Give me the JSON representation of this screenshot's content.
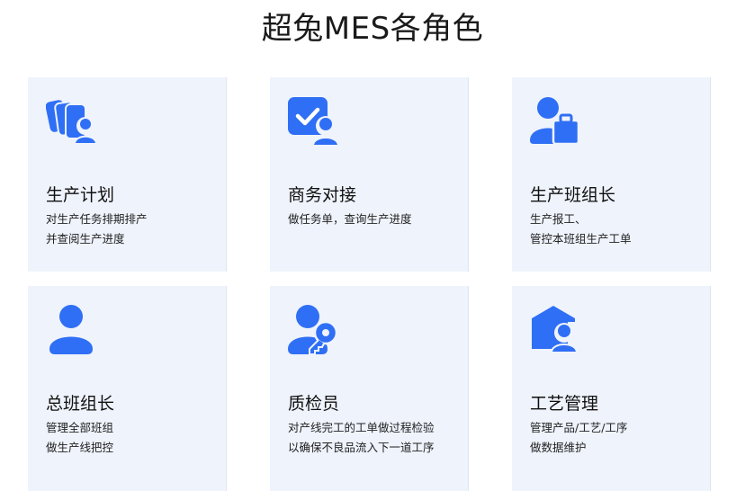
{
  "title": "超兔MES各角色",
  "brand_color": "#2f6ff5",
  "roles": [
    {
      "icon": "people-stack-icon",
      "title": "生产计划",
      "desc": [
        "对生产任务排期排产",
        "并查阅生产进度"
      ]
    },
    {
      "icon": "task-check-user-icon",
      "title": "商务对接",
      "desc": [
        "做任务单，查询生产进度"
      ]
    },
    {
      "icon": "user-briefcase-icon",
      "title": "生产班组长",
      "desc": [
        "生产报工、",
        "管控本班组生产工单"
      ]
    },
    {
      "icon": "user-icon",
      "title": "总班组长",
      "desc": [
        "管理全部班组",
        "做生产线把控"
      ]
    },
    {
      "icon": "user-key-icon",
      "title": "质检员",
      "desc": [
        "对产线完工的工单做过程检验",
        "以确保不良品流入下一道工序"
      ]
    },
    {
      "icon": "house-user-icon",
      "title": "工艺管理",
      "desc": [
        "管理产品/工艺/工序",
        "做数据维护"
      ]
    }
  ]
}
